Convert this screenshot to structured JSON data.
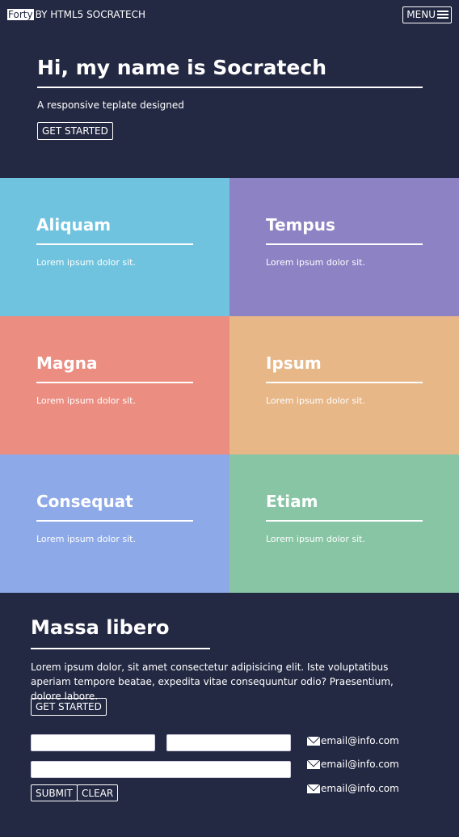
{
  "header": {
    "logo": "Forty",
    "byline": "BY HTML5 SOCRATECH",
    "menu_label": "MENU"
  },
  "banner": {
    "title": "Hi, my name is Socratech",
    "subtitle": "A responsive teplate designed",
    "button": "GET STARTED"
  },
  "tiles": [
    {
      "title": "Aliquam",
      "text": "Lorem ipsum dolor sit.",
      "color": "#6fc3df"
    },
    {
      "title": "Tempus",
      "text": "Lorem ipsum dolor sit.",
      "color": "#8d82c4"
    },
    {
      "title": "Magna",
      "text": "Lorem ipsum dolor sit.",
      "color": "#ec8d81"
    },
    {
      "title": "Ipsum",
      "text": "Lorem ipsum dolor sit.",
      "color": "#e7b788"
    },
    {
      "title": "Consequat",
      "text": "Lorem ipsum dolor sit.",
      "color": "#8ea9e8"
    },
    {
      "title": "Etiam",
      "text": "Lorem ipsum dolor sit.",
      "color": "#87c5a4"
    }
  ],
  "contact": {
    "title": "Massa libero",
    "description": "Lorem ipsum dolor, sit amet consectetur adipisicing elit. Iste voluptatibus aperiam tempore beatae, expedita vitae consequuntur odio? Praesentium, dolore labore.",
    "button": "GET STARTED",
    "submit_label": "SUBMIT",
    "clear_label": "CLEAR",
    "emails": [
      "email@info.com",
      "email@info.com",
      "email@info.com"
    ]
  },
  "colors": {
    "background": "#242943",
    "text": "#ffffff"
  }
}
